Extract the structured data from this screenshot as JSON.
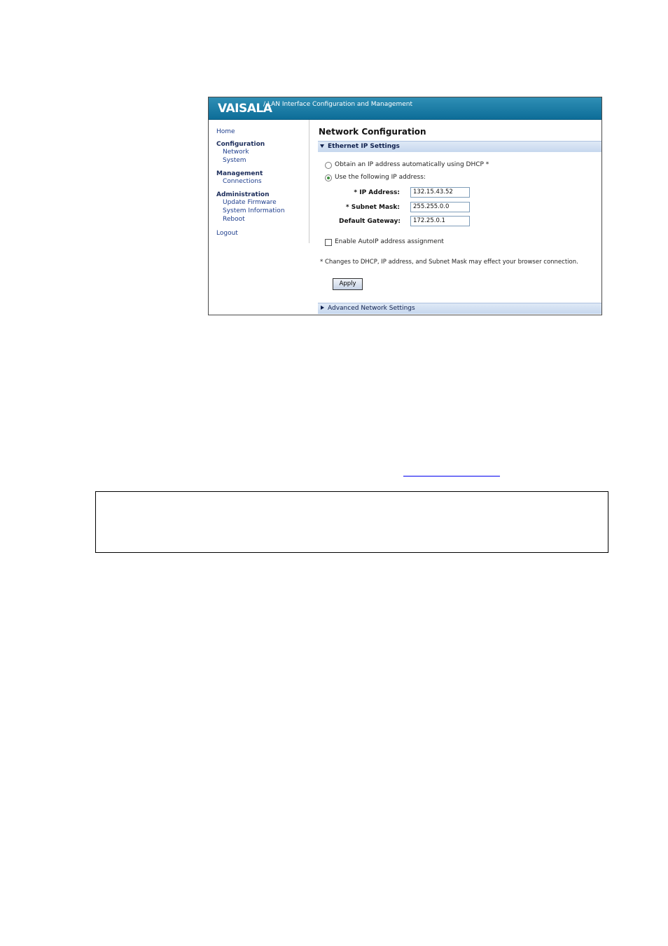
{
  "header": {
    "logo": "VAISALA",
    "title": "/ LAN Interface Configuration and Management"
  },
  "nav": {
    "home": "Home",
    "configuration": "Configuration",
    "network": "Network",
    "system": "System",
    "management": "Management",
    "connections": "Connections",
    "administration": "Administration",
    "update_firmware": "Update Firmware",
    "system_information": "System Information",
    "reboot": "Reboot",
    "logout": "Logout"
  },
  "main": {
    "page_title": "Network Configuration",
    "section_ethernet": "Ethernet IP Settings",
    "radio_dhcp_label": "Obtain an IP address automatically using DHCP *",
    "radio_static_label": "Use the following IP address:",
    "radio_selected": "static",
    "ip_address_label": "* IP Address:",
    "ip_address_value": "132.15.43.52",
    "subnet_mask_label": "* Subnet Mask:",
    "subnet_mask_value": "255.255.0.0",
    "gateway_label": "Default Gateway:",
    "gateway_value": "172.25.0.1",
    "autoip_label": "Enable AutoIP address assignment",
    "autoip_checked": false,
    "note": "* Changes to DHCP, IP address, and Subnet Mask may effect your browser connection.",
    "apply_label": "Apply",
    "section_advanced": "Advanced Network Settings"
  },
  "colors": {
    "header_blue": "#0d6d98",
    "nav_link": "#1d3d8c",
    "section_bar": "#c6d7ee"
  }
}
